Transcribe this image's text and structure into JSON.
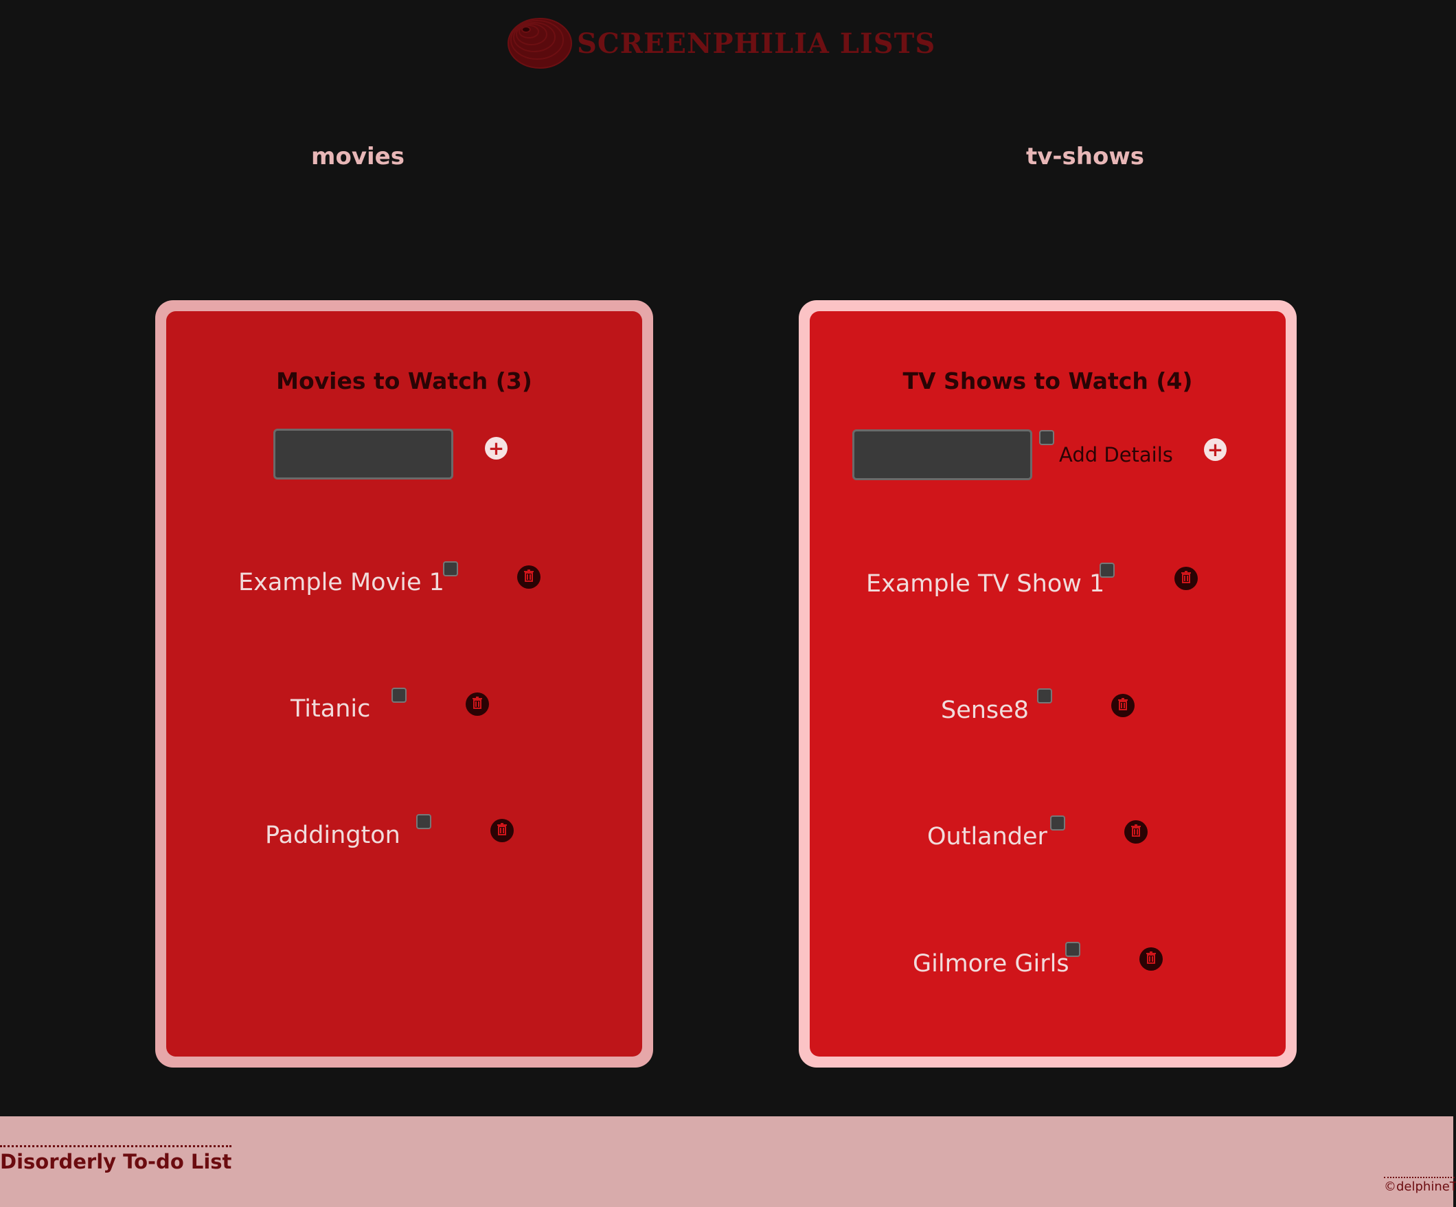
{
  "header": {
    "logo_text": "SCREENPHILIA LISTS",
    "logo_icon": "film-reel-icon"
  },
  "tabs": [
    {
      "label": "movies"
    },
    {
      "label": "tv-shows"
    }
  ],
  "movies": {
    "title": "Movies to Watch (3)",
    "input_value": "",
    "add_icon": "plus-icon",
    "items": [
      {
        "label": "Example Movie 1",
        "checked": false
      },
      {
        "label": "Titanic",
        "checked": false
      },
      {
        "label": "Paddington",
        "checked": false
      }
    ]
  },
  "tv": {
    "title": "TV Shows to Watch (4)",
    "input_value": "",
    "details_label": "Add Details",
    "add_icon": "plus-icon",
    "items": [
      {
        "label": "Example TV Show 1",
        "checked": false
      },
      {
        "label": "Sense8",
        "checked": false
      },
      {
        "label": "Outlander",
        "checked": false
      },
      {
        "label": "Gilmore Girls",
        "checked": false
      }
    ]
  },
  "footer": {
    "link": "Disorderly To-do List",
    "credit": "©delphineT"
  },
  "colors": {
    "background": "#121212",
    "movies_card": "#be1519",
    "tv_card": "#d0151a",
    "footer": "#d8abab"
  }
}
